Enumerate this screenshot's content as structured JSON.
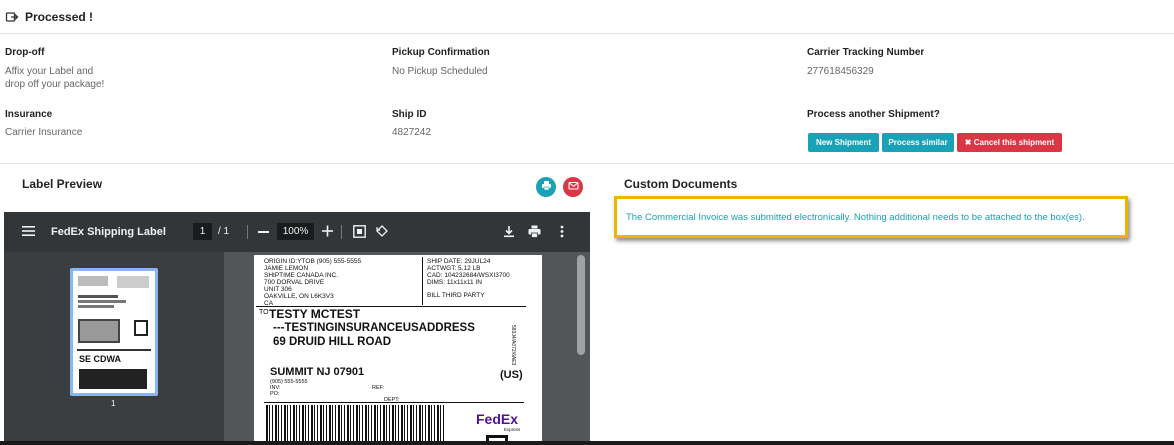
{
  "header": {
    "title": "Processed !",
    "icon": "share-arrow-icon"
  },
  "dropoff": {
    "label": "Drop-off",
    "value_line1": "Affix your Label and",
    "value_line2": "drop off your package!"
  },
  "pickup": {
    "label": "Pickup Confirmation",
    "value": "No Pickup Scheduled"
  },
  "tracking": {
    "label": "Carrier Tracking Number",
    "value": "277618456329"
  },
  "insurance": {
    "label": "Insurance",
    "value": "Carrier Insurance"
  },
  "shipid": {
    "label": "Ship ID",
    "value": "4827242"
  },
  "process": {
    "label": "Process another Shipment?",
    "new_label": "New Shipment",
    "similar_label": "Process similar",
    "cancel_label": "✖ Cancel this shipment"
  },
  "label_preview": {
    "title": "Label Preview",
    "print_icon": "print-icon",
    "email_icon": "email-icon"
  },
  "pdf_viewer": {
    "title": "FedEx Shipping Label",
    "page_current": "1",
    "page_total": "/ 1",
    "zoom": "100%",
    "thumb_page": "1",
    "label": {
      "origin": "ORIGIN ID:YTOB      (905) 555-5555",
      "sender_name": "JAMIE LEMON",
      "sender_company": "SHIPTIME CANADA INC.",
      "sender_street": "700 DORVAL DRIVE",
      "sender_unit": "UNIT 306",
      "sender_city": "OAKVILLE, ON L6K3V3",
      "sender_country": "CA",
      "ship_date": "SHIP DATE: 29JUL24",
      "actwgt": "ACTWGT: 5.12 LB",
      "cad": "CAD: 104232684/WSXI3700",
      "dims": "DIMS: 11x11x11 IN",
      "bill": "BILL THIRD PARTY",
      "to": "TO",
      "recipient_name": "TESTY MCTEST",
      "recipient_line2": "---TESTINGINSURANCEUSADDRESS",
      "recipient_street": "69 DRUID HILL ROAD",
      "recipient_city": "SUMMIT NJ 07901",
      "recipient_country": "(US)",
      "recipient_phone": "(905) 555-5555",
      "ref": "REF:",
      "inv": "INV:",
      "po": "PO:",
      "dept": "DEPT:",
      "side_code": "583J4/A072/6AE3",
      "fedex_logo": "FedEx",
      "fedex_sub": "Express",
      "thumb_service": "SE CDWA"
    }
  },
  "custom_docs": {
    "title": "Custom Documents",
    "message": "The Commercial Invoice was submitted electronically. Nothing additional needs to be attached to the box(es)."
  }
}
